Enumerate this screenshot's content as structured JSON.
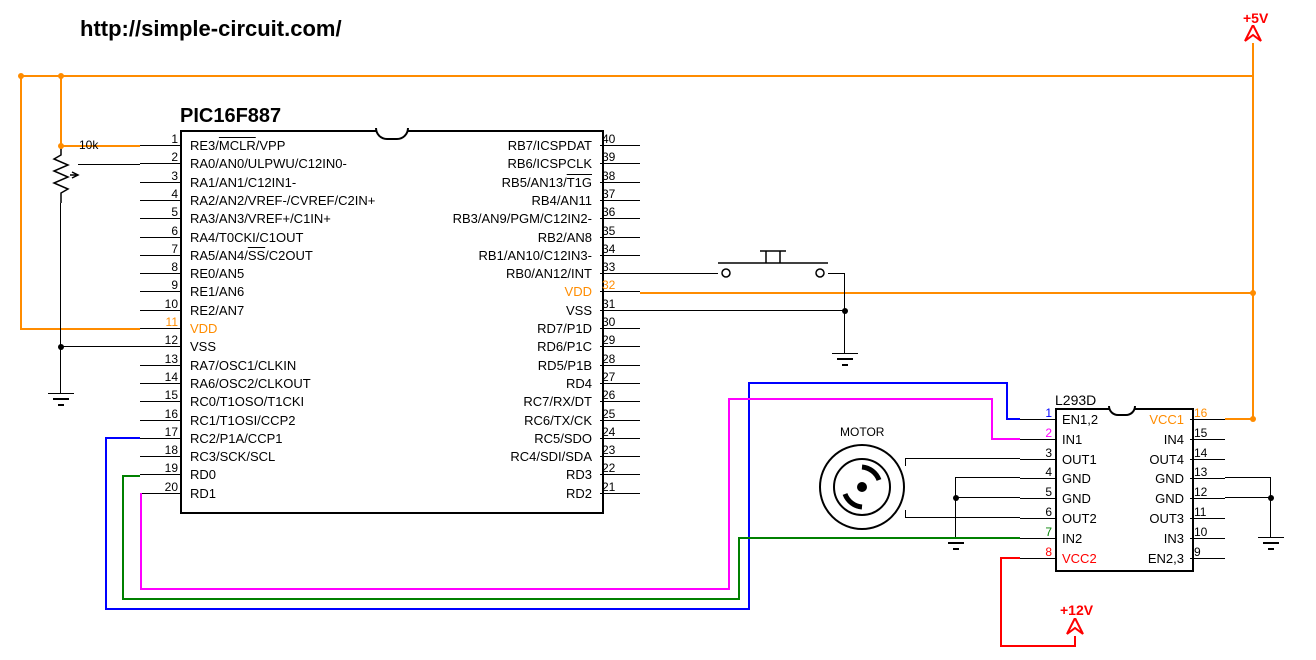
{
  "url": "http://simple-circuit.com/",
  "voltage_5v": "+5V",
  "voltage_12v": "+12V",
  "resistor_label": "10k",
  "motor_label": "MOTOR",
  "pic": {
    "title": "PIC16F887",
    "left_pins": [
      {
        "num": "1",
        "label": "RE3/MCLR/VPP",
        "overline": "MCLR"
      },
      {
        "num": "2",
        "label": "RA0/AN0/ULPWU/C12IN0-"
      },
      {
        "num": "3",
        "label": "RA1/AN1/C12IN1-"
      },
      {
        "num": "4",
        "label": "RA2/AN2/VREF-/CVREF/C2IN+"
      },
      {
        "num": "5",
        "label": "RA3/AN3/VREF+/C1IN+"
      },
      {
        "num": "6",
        "label": "RA4/T0CKI/C1OUT"
      },
      {
        "num": "7",
        "label": "RA5/AN4/SS/C2OUT",
        "overline": "SS"
      },
      {
        "num": "8",
        "label": "RE0/AN5"
      },
      {
        "num": "9",
        "label": "RE1/AN6"
      },
      {
        "num": "10",
        "label": "RE2/AN7"
      },
      {
        "num": "11",
        "label": "VDD",
        "orange": true
      },
      {
        "num": "12",
        "label": "VSS"
      },
      {
        "num": "13",
        "label": "RA7/OSC1/CLKIN"
      },
      {
        "num": "14",
        "label": "RA6/OSC2/CLKOUT"
      },
      {
        "num": "15",
        "label": "RC0/T1OSO/T1CKI"
      },
      {
        "num": "16",
        "label": "RC1/T1OSI/CCP2"
      },
      {
        "num": "17",
        "label": "RC2/P1A/CCP1"
      },
      {
        "num": "18",
        "label": "RC3/SCK/SCL"
      },
      {
        "num": "19",
        "label": "RD0"
      },
      {
        "num": "20",
        "label": "RD1"
      }
    ],
    "right_pins": [
      {
        "num": "40",
        "label": "RB7/ICSPDAT"
      },
      {
        "num": "39",
        "label": "RB6/ICSPCLK"
      },
      {
        "num": "38",
        "label": "RB5/AN13/T1G",
        "overline": "T1G"
      },
      {
        "num": "37",
        "label": "RB4/AN11"
      },
      {
        "num": "36",
        "label": "RB3/AN9/PGM/C12IN2-"
      },
      {
        "num": "35",
        "label": "RB2/AN8"
      },
      {
        "num": "34",
        "label": "RB1/AN10/C12IN3-"
      },
      {
        "num": "33",
        "label": "RB0/AN12/INT"
      },
      {
        "num": "32",
        "label": "VDD",
        "orange": true
      },
      {
        "num": "31",
        "label": "VSS"
      },
      {
        "num": "30",
        "label": "RD7/P1D"
      },
      {
        "num": "29",
        "label": "RD6/P1C"
      },
      {
        "num": "28",
        "label": "RD5/P1B"
      },
      {
        "num": "27",
        "label": "RD4"
      },
      {
        "num": "26",
        "label": "RC7/RX/DT"
      },
      {
        "num": "25",
        "label": "RC6/TX/CK"
      },
      {
        "num": "24",
        "label": "RC5/SDO"
      },
      {
        "num": "23",
        "label": "RC4/SDI/SDA"
      },
      {
        "num": "22",
        "label": "RD3"
      },
      {
        "num": "21",
        "label": "RD2"
      }
    ]
  },
  "l293d": {
    "title": "L293D",
    "left_pins": [
      {
        "num": "1",
        "label": "EN1,2"
      },
      {
        "num": "2",
        "label": "IN1"
      },
      {
        "num": "3",
        "label": "OUT1"
      },
      {
        "num": "4",
        "label": "GND"
      },
      {
        "num": "5",
        "label": "GND"
      },
      {
        "num": "6",
        "label": "OUT2"
      },
      {
        "num": "7",
        "label": "IN2"
      },
      {
        "num": "8",
        "label": "VCC2",
        "red": true
      }
    ],
    "right_pins": [
      {
        "num": "16",
        "label": "VCC1",
        "orange": true
      },
      {
        "num": "15",
        "label": "IN4"
      },
      {
        "num": "14",
        "label": "OUT4"
      },
      {
        "num": "13",
        "label": "GND"
      },
      {
        "num": "12",
        "label": "GND"
      },
      {
        "num": "11",
        "label": "OUT3"
      },
      {
        "num": "10",
        "label": "IN3"
      },
      {
        "num": "9",
        "label": "EN2,3"
      }
    ]
  }
}
